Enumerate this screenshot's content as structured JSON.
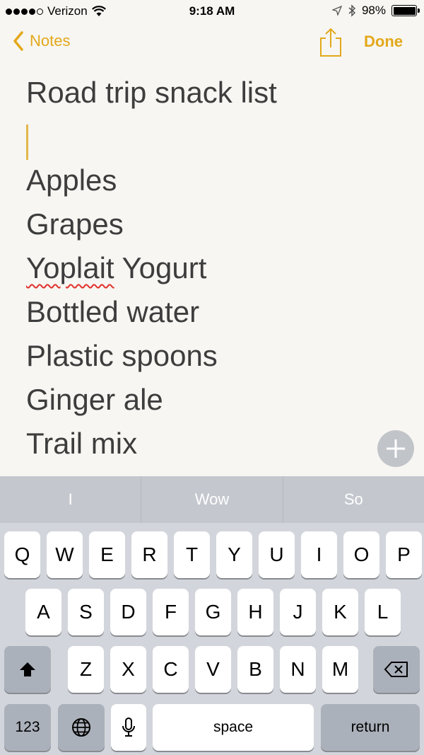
{
  "status_bar": {
    "carrier": "Verizon",
    "time": "9:18 AM",
    "battery": "98%",
    "battery_level": 0.98
  },
  "nav": {
    "back_label": "Notes",
    "done_label": "Done"
  },
  "note": {
    "title": "Road trip snack list",
    "lines": [
      "Apples",
      "Grapes",
      "Yoplait",
      "Yogurt",
      "Bottled water",
      "Plastic spoons",
      "Ginger ale",
      "Trail mix"
    ]
  },
  "suggestions": [
    "I",
    "Wow",
    "So"
  ],
  "keyboard": {
    "row1": [
      "Q",
      "W",
      "E",
      "R",
      "T",
      "Y",
      "U",
      "I",
      "O",
      "P"
    ],
    "row2": [
      "A",
      "S",
      "D",
      "F",
      "G",
      "H",
      "J",
      "K",
      "L"
    ],
    "row3": [
      "Z",
      "X",
      "C",
      "V",
      "B",
      "N",
      "M"
    ],
    "numbers_label": "123",
    "space_label": "space",
    "return_label": "return"
  },
  "colors": {
    "accent": "#e3a81b",
    "note_text": "#3d3d3d",
    "keyboard_bg": "#d2d5db",
    "suggestion_bar": "#c4c8ce"
  }
}
